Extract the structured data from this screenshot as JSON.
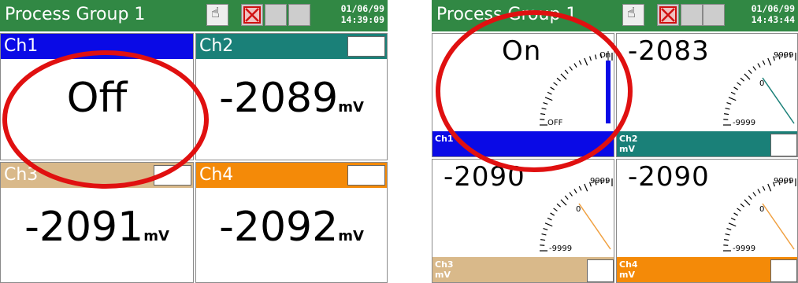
{
  "left": {
    "title": "Process Group 1",
    "date": "01/06/99",
    "time": "14:39:09",
    "channels": [
      {
        "label": "Ch1",
        "value": "Off",
        "unit": "",
        "color": "#0a0ae6"
      },
      {
        "label": "Ch2",
        "value": "-2089",
        "unit": "mV",
        "color": "#1a8078"
      },
      {
        "label": "Ch3",
        "value": "-2091",
        "unit": "mV",
        "color": "#d9b98a"
      },
      {
        "label": "Ch4",
        "value": "-2092",
        "unit": "mV",
        "color": "#f48a08"
      }
    ]
  },
  "right": {
    "title": "Process Group 1",
    "date": "01/06/99",
    "time": "14:43:44",
    "channels": [
      {
        "label": "Ch1",
        "unit": "",
        "value": "On",
        "scale_top": "On",
        "scale_bottom": "OFF",
        "color": "#0a0ae6",
        "needle_color": "#0a0ae6"
      },
      {
        "label": "Ch2",
        "unit": "mV",
        "value": "-2083",
        "scale_top": "9999",
        "scale_mid": "0",
        "scale_bottom": "-9999",
        "color": "#1a8078",
        "needle_color": "#1a8078"
      },
      {
        "label": "Ch3",
        "unit": "mV",
        "value": "-2090",
        "scale_top": "9999",
        "scale_mid": "0",
        "scale_bottom": "-9999",
        "color": "#d9b98a",
        "needle_color": "#f0a040"
      },
      {
        "label": "Ch4",
        "unit": "mV",
        "value": "-2090",
        "scale_top": "9999",
        "scale_mid": "0",
        "scale_bottom": "-9999",
        "color": "#f48a08",
        "needle_color": "#f0a040"
      }
    ]
  },
  "icons": {
    "hand": "hand-pointer-icon",
    "alarm": "alarm-x-icon",
    "blank": "status-square-icon"
  },
  "annotation_color": "#e01010"
}
